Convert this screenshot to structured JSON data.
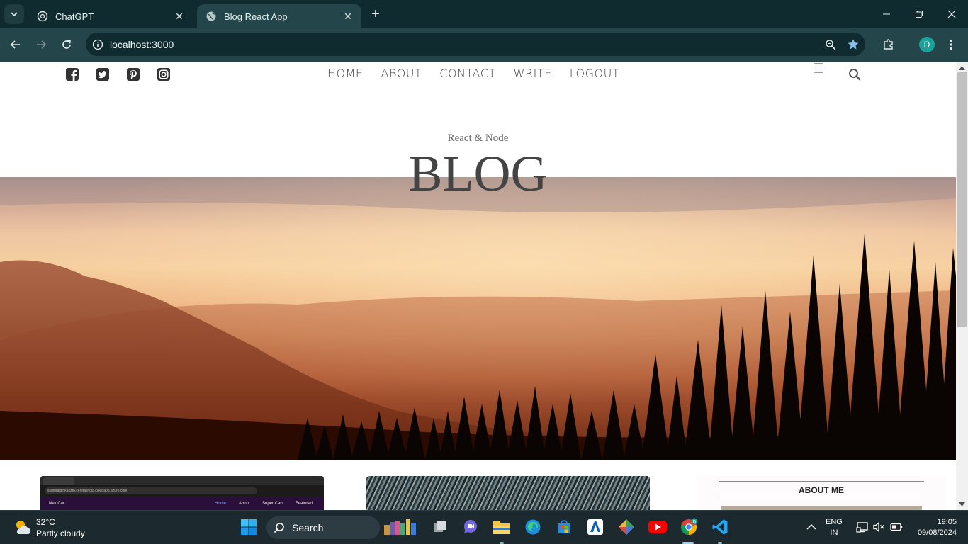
{
  "browser": {
    "tabs": [
      {
        "title": "ChatGPT",
        "active": false
      },
      {
        "title": "Blog React App",
        "active": true
      }
    ],
    "url": "localhost:3000",
    "profile_initial": "D",
    "accent": "#1aa39a"
  },
  "site": {
    "social_icons": [
      "facebook-icon",
      "twitter-icon",
      "pinterest-icon",
      "instagram-icon"
    ],
    "menu": [
      "HOME",
      "ABOUT",
      "CONTACT",
      "WRITE",
      "LOGOUT"
    ],
    "header_small": "React & Node",
    "header_large": "BLOG",
    "post1_thumb": {
      "url": "ssumraldinkanzto.centralindia.cloudapp.azure.com",
      "brand": "NextCar",
      "links": [
        "Home",
        "About",
        "Super Cars",
        "Featured"
      ]
    },
    "sidebar_title": "ABOUT ME"
  },
  "taskbar": {
    "weather_temp": "32°C",
    "weather_desc": "Partly cloudy",
    "search_label": "Search",
    "lang_line1": "ENG",
    "lang_line2": "IN",
    "time": "19:05",
    "date": "09/08/2024"
  }
}
